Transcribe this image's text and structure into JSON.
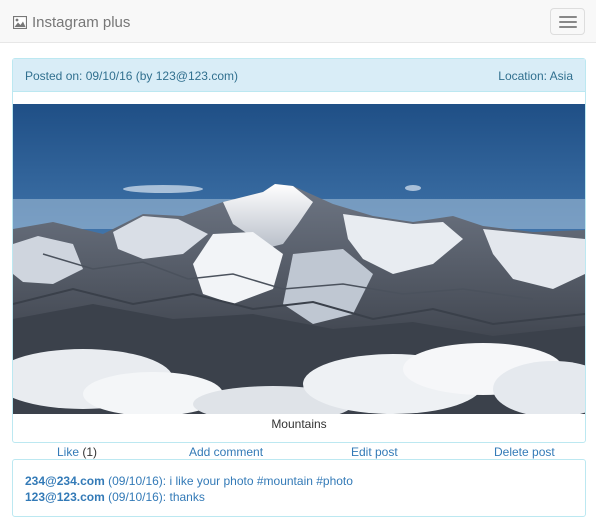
{
  "navbar": {
    "brand": "Instagram plus",
    "brand_icon": "picture-icon",
    "toggle_icon": "hamburger-menu-icon"
  },
  "post": {
    "posted_on": "Posted on: 09/10/16 (by 123@123.com)",
    "location": "Location: Asia",
    "caption": "Mountains",
    "actions": {
      "like_label": "Like",
      "like_count": "(1)",
      "add_comment": "Add comment",
      "edit_post": "Edit post",
      "delete_post": "Delete post"
    }
  },
  "comments": [
    {
      "user": "234@234.com",
      "meta": " (09/10/16): ",
      "text": "i like your photo #mountain #photo"
    },
    {
      "user": "123@123.com",
      "meta": " (09/10/16): ",
      "text": "thanks"
    }
  ],
  "colors": {
    "navbar_bg": "#f8f8f8",
    "panel_heading_bg": "#d9edf7",
    "panel_border": "#bce8f1",
    "heading_text": "#31708f",
    "link": "#337ab7"
  }
}
